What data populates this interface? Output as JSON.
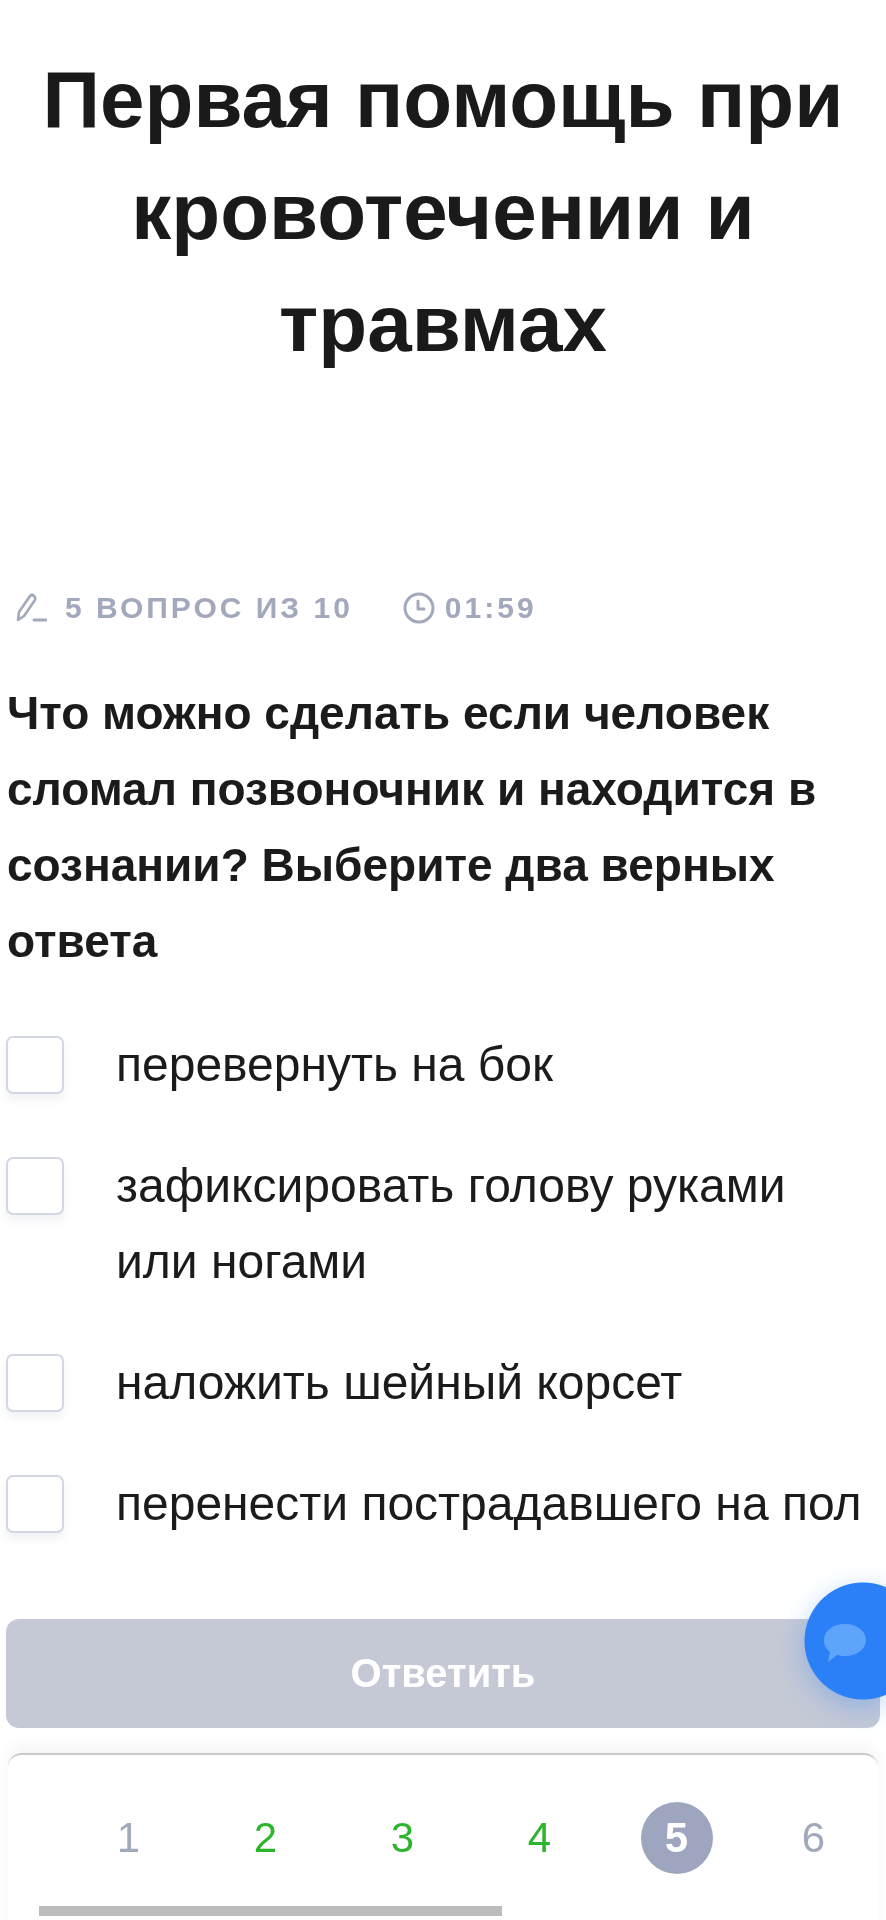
{
  "title": "Первая помощь при кровотечении и травмах",
  "progress": {
    "label": "5 ВОПРОС ИЗ 10",
    "timer": "01:59"
  },
  "question": "Что можно сделать если человек сломал позвоночник и находится в сознании? Выберите два верных ответа",
  "options": [
    {
      "label": "перевернуть на бок",
      "checked": false
    },
    {
      "label": "зафиксировать голову руками или ногами",
      "checked": false
    },
    {
      "label": "наложить шейный корсет",
      "checked": false
    },
    {
      "label": "перенести пострадавшего на пол",
      "checked": false
    }
  ],
  "answer_button": {
    "label": "Ответить",
    "disabled": true
  },
  "pagination": [
    {
      "label": "1",
      "selected": false,
      "answered": false
    },
    {
      "label": "2",
      "selected": false,
      "answered": true
    },
    {
      "label": "3",
      "selected": false,
      "answered": true
    },
    {
      "label": "4",
      "selected": false,
      "answered": true
    },
    {
      "label": "5",
      "selected": true,
      "answered": false
    },
    {
      "label": "6",
      "selected": false,
      "answered": false
    }
  ]
}
